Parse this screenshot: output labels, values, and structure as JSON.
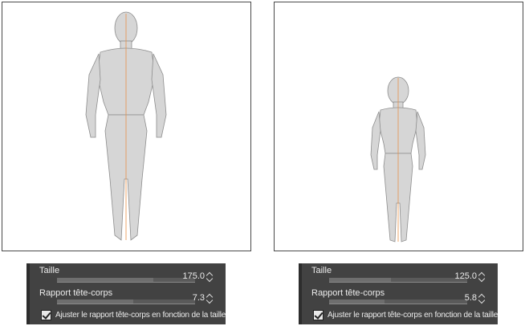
{
  "viewports": [
    {
      "name": "adult-model-viewport",
      "figure_scale": 1.0
    },
    {
      "name": "child-model-viewport",
      "figure_scale": 0.714
    }
  ],
  "panels": [
    {
      "height_label": "Taille",
      "height_value": "175.0",
      "height_fill_fraction": 0.7,
      "ratio_label": "Rapport tête-corps",
      "ratio_value": "7.3",
      "ratio_fill_fraction": 0.55,
      "checkbox_label": "Ajuster le rapport tête-corps en fonction de la taille",
      "checkbox_checked": true
    },
    {
      "height_label": "Taille",
      "height_value": "125.0",
      "height_fill_fraction": 0.45,
      "ratio_label": "Rapport tête-corps",
      "ratio_value": "5.8",
      "ratio_fill_fraction": 0.4,
      "checkbox_label": "Ajuster le rapport tête-corps en fonction de la taille",
      "checkbox_checked": true
    }
  ],
  "colors": {
    "accent_line": "#e8924a",
    "panel_bg": "#424242",
    "figure": "#d9d9d9"
  }
}
